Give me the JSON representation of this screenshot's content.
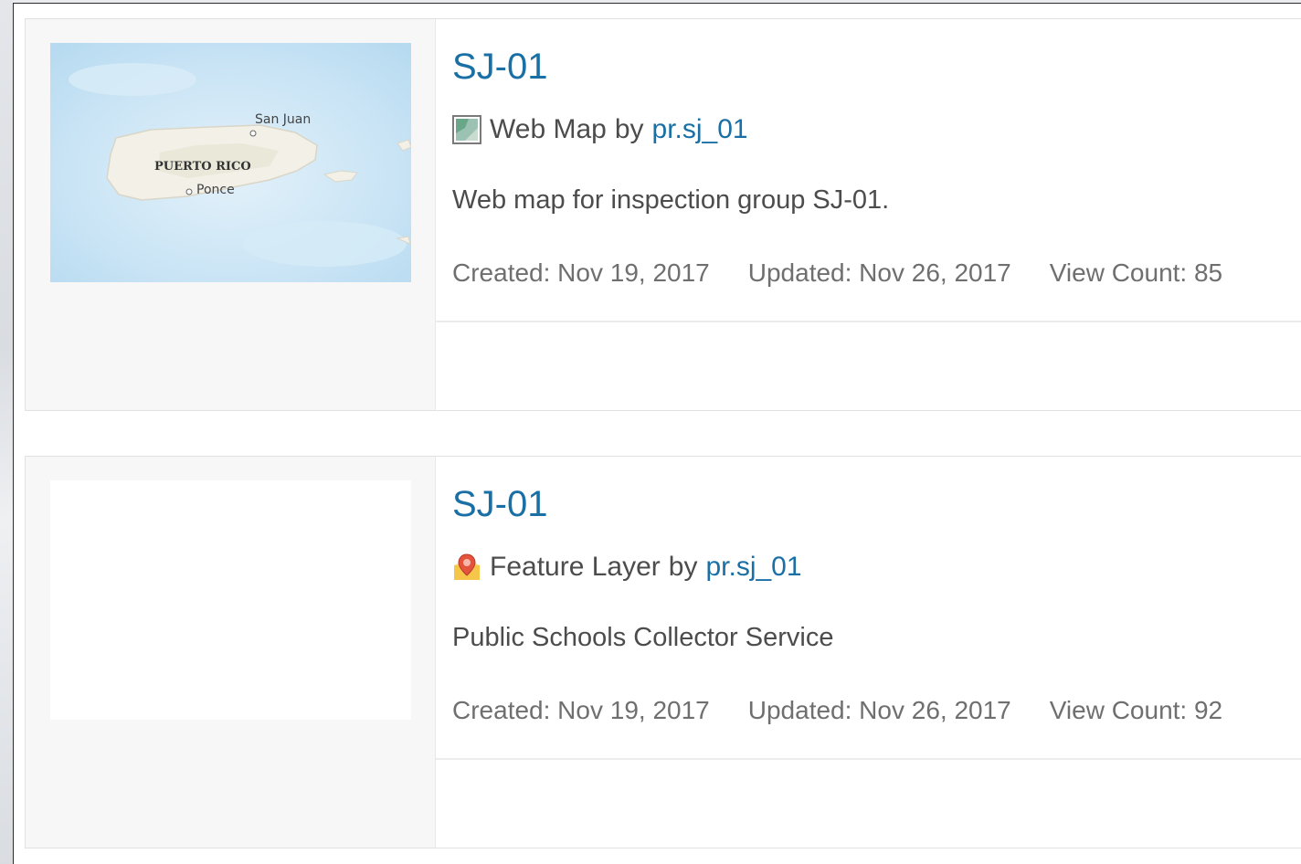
{
  "items": [
    {
      "title": "SJ-01",
      "type": "Web Map",
      "by": "by",
      "owner": "pr.sj_01",
      "description": "Web map for inspection group SJ-01.",
      "created": "Created: Nov 19, 2017",
      "updated": "Updated: Nov 26, 2017",
      "views": "View Count: 85",
      "type_icon": "web-map-icon",
      "thumbnail": {
        "kind": "map",
        "labels": {
          "city1": "San Juan",
          "island": "PUERTO RICO",
          "city2": "Ponce"
        }
      }
    },
    {
      "title": "SJ-01",
      "type": "Feature Layer",
      "by": "by",
      "owner": "pr.sj_01",
      "description": "Public Schools Collector Service",
      "created": "Created: Nov 19, 2017",
      "updated": "Updated: Nov 26, 2017",
      "views": "View Count: 92",
      "type_icon": "feature-layer-icon",
      "thumbnail": {
        "kind": "blank"
      }
    }
  ],
  "colors": {
    "link": "#1a6fa5",
    "text": "#4c4c4c",
    "meta": "#6f6f6f",
    "water": "#cfe7f6",
    "land": "#f1efe6"
  }
}
